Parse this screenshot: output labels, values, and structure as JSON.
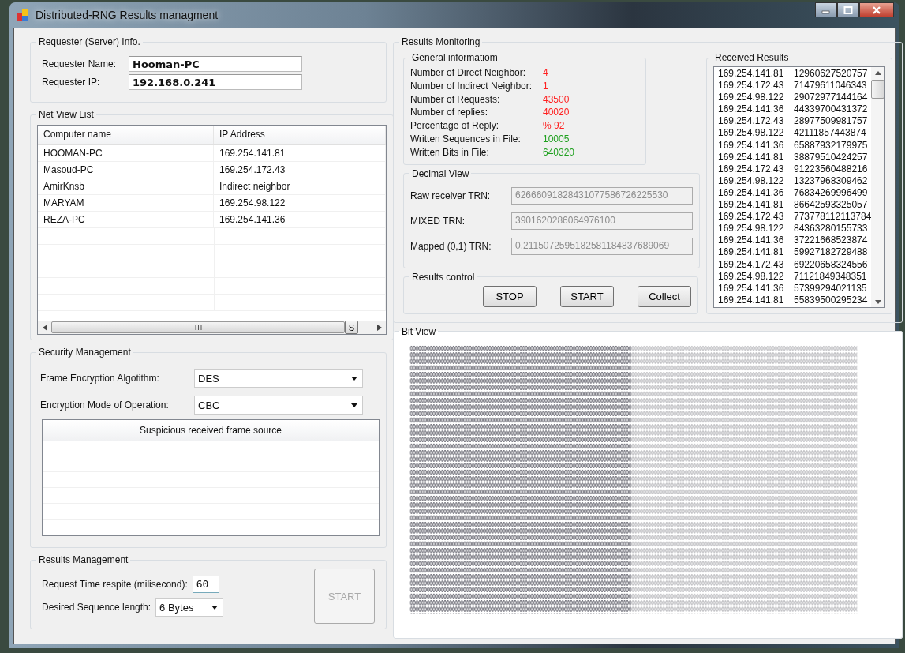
{
  "window": {
    "title": "Distributed-RNG Results managment"
  },
  "requester_info": {
    "title": "Requester (Server) Info.",
    "fields": [
      {
        "label": "Requester Name:",
        "value": "Hooman-PC"
      },
      {
        "label": "Requester IP:",
        "value": "192.168.0.241"
      }
    ]
  },
  "net_view_list": {
    "title": "Net View List",
    "columns": [
      "Computer name",
      "IP Address"
    ],
    "rows": [
      {
        "computer_name": "HOOMAN-PC",
        "ip_address": "169.254.141.81"
      },
      {
        "computer_name": "Masoud-PC",
        "ip_address": "169.254.172.43"
      },
      {
        "computer_name": "AmirKnsb",
        "ip_address": "Indirect neighbor"
      },
      {
        "computer_name": "MARYAM",
        "ip_address": "169.254.98.122"
      },
      {
        "computer_name": "REZA-PC",
        "ip_address": "169.254.141.36"
      }
    ],
    "side_button": "S"
  },
  "security_management": {
    "title": "Security Management",
    "fields": [
      {
        "label": "Frame Encryption Algotithm:",
        "value": "DES"
      },
      {
        "label": "Encryption Mode of Operation:",
        "value": "CBC"
      }
    ],
    "suspicious_table": {
      "columns": [
        "Suspicious received frame source"
      ]
    }
  },
  "results_management": {
    "title": "Results Management",
    "time_label": "Request Time respite (milisecond):",
    "time_value": "60",
    "length_label": "Desired Sequence length:",
    "length_value": "6 Bytes",
    "start_button": {
      "label": "START",
      "disabled": true
    }
  },
  "results_monitoring": {
    "title": "Results Monitoring",
    "general_information": {
      "title": "General informatiom",
      "items": [
        {
          "label": "Number of Direct Neighbor:",
          "value": "4",
          "color": "#ff2020"
        },
        {
          "label": "Number of Indirect Neighbor:",
          "value": "1",
          "color": "#ff2020"
        },
        {
          "label": "Number of Requests:",
          "value": "43500",
          "color": "#ff2020"
        },
        {
          "label": "Number of replies:",
          "value": "40020",
          "color": "#ff2020"
        },
        {
          "label": "Percentage of Reply:",
          "value": "% 92",
          "color": "#ff2020"
        },
        {
          "label": "Written Sequences in File:",
          "value": "10005",
          "color": "#1fa01f"
        },
        {
          "label": "Written Bits in File:",
          "value": "640320",
          "color": "#1fa01f"
        }
      ]
    },
    "decimal_view": {
      "title": "Decimal View",
      "fields": [
        {
          "label": "Raw receiver TRN:",
          "value": "62666091828431077586726225530",
          "disabled": true
        },
        {
          "label": "MIXED TRN:",
          "value": "3901620286064976100",
          "disabled": true
        },
        {
          "label": "Mapped (0,1) TRN:",
          "value": "0.2115072595182581184837689069",
          "disabled": true
        }
      ]
    },
    "results_control": {
      "title": "Results control",
      "buttons": [
        {
          "label": "STOP",
          "disabled": false
        },
        {
          "label": "START",
          "disabled": false
        },
        {
          "label": "Collect",
          "disabled": false
        }
      ]
    },
    "received_results": {
      "title": "Received Results",
      "rows": [
        {
          "ip": "169.254.141.81",
          "number": "12960627520757"
        },
        {
          "ip": "169.254.172.43",
          "number": "71479611046343"
        },
        {
          "ip": "169.254.98.122",
          "number": "29072977144164"
        },
        {
          "ip": "169.254.141.36",
          "number": "44339700431372"
        },
        {
          "ip": "169.254.172.43",
          "number": "28977509981757"
        },
        {
          "ip": "169.254.98.122",
          "number": "42111857443874"
        },
        {
          "ip": "169.254.141.36",
          "number": "65887932179975"
        },
        {
          "ip": "169.254.141.81",
          "number": "38879510424257"
        },
        {
          "ip": "169.254.172.43",
          "number": "91223560488216"
        },
        {
          "ip": "169.254.98.122",
          "number": "13237968309462"
        },
        {
          "ip": "169.254.141.36",
          "number": "76834269996499"
        },
        {
          "ip": "169.254.141.81",
          "number": "86642593325057"
        },
        {
          "ip": "169.254.172.43",
          "number": "773778112113784"
        },
        {
          "ip": "169.254.98.122",
          "number": "84363280155733"
        },
        {
          "ip": "169.254.141.36",
          "number": "37221668523874"
        },
        {
          "ip": "169.254.141.81",
          "number": "59927182729488"
        },
        {
          "ip": "169.254.172.43",
          "number": "69220658324556"
        },
        {
          "ip": "169.254.98.122",
          "number": "71121849348351"
        },
        {
          "ip": "169.254.141.36",
          "number": "57399294021135"
        },
        {
          "ip": "169.254.141.81",
          "number": "55839500295234"
        }
      ]
    }
  },
  "bit_view": {
    "title": "Bit View"
  }
}
